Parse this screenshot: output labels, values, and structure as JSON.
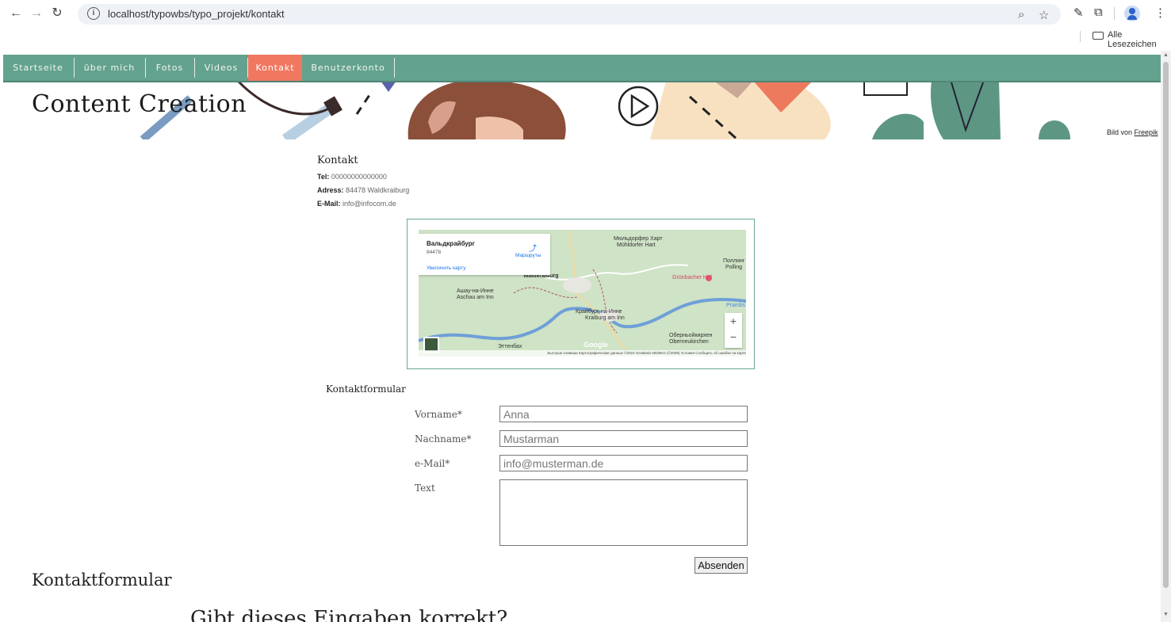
{
  "browser": {
    "url": "localhost/typowbs/typo_projekt/kontakt",
    "bookmarks_label": "Alle Lesezeichen"
  },
  "nav": {
    "items": [
      {
        "label": "Startseite"
      },
      {
        "label": "über mich"
      },
      {
        "label": "Fotos"
      },
      {
        "label": "Videos"
      },
      {
        "label": "Kontakt"
      },
      {
        "label": "Benutzerkonto"
      }
    ],
    "active_index": 4,
    "bar_color": "#63a28e",
    "active_color": "#f07860"
  },
  "hero": {
    "title": "Content Creation",
    "credit_prefix": "Bild von",
    "credit_link": "Freepik"
  },
  "contact": {
    "heading": "Kontakt",
    "tel_label": "Tel:",
    "tel_value": "00000000000000",
    "address_label": "Adress:",
    "address_value": "84478 Waldkraiburg",
    "email_label": "E-Mail:",
    "email_value": "info@infocom.de"
  },
  "map": {
    "place_name": "Вальдкрайбург",
    "zip": "84478",
    "enlarge_link": "Увеличить карту",
    "routes_label": "Маршруты",
    "labels": [
      "Мюльдорфер Харт",
      "Mühldorfer Hart",
      "Waldkraiburg",
      "Ашау-на-Инне",
      "Aschau am Inn",
      "Крайбург-на-Инне",
      "Kraiburg am Inn",
      "Grünbacher Hof",
      "Поллинг",
      "Polling",
      "Оберньойкирхен",
      "Oberneukirchen",
      "Эттенбах",
      "Prambs"
    ],
    "google_label": "Google",
    "footer_text": "Быстрые клавиши   Картографические данные ©2024 GeoBasis-DE/BKG (©2009)   Условия   Сообщить об ошибке на карте",
    "zoom_in": "+",
    "zoom_out": "−"
  },
  "form": {
    "heading": "Kontaktformular",
    "fields": [
      {
        "label": "Vorname*",
        "value": "Anna"
      },
      {
        "label": "Nachname*",
        "value": "Mustarman"
      },
      {
        "label": "e-Mail*",
        "value": "info@musterman.de"
      },
      {
        "label": "Text",
        "value": ""
      }
    ],
    "submit_label": "Absenden"
  },
  "footer": {
    "heading": "Kontaktformular",
    "sub": "Gibt dieses Eingaben korrekt?"
  }
}
